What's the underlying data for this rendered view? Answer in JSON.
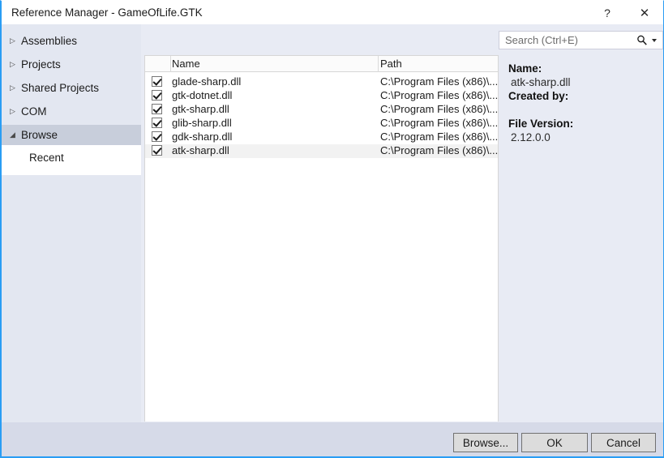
{
  "window": {
    "title": "Reference Manager - GameOfLife.GTK",
    "help_label": "?",
    "close_label": "✕"
  },
  "sidebar": {
    "items": [
      {
        "label": "Assemblies",
        "marker": "▷",
        "selected": false
      },
      {
        "label": "Projects",
        "marker": "▷",
        "selected": false
      },
      {
        "label": "Shared Projects",
        "marker": "▷",
        "selected": false
      },
      {
        "label": "COM",
        "marker": "▷",
        "selected": false
      },
      {
        "label": "Browse",
        "marker": "◢",
        "selected": true
      }
    ],
    "sub_item": {
      "label": "Recent"
    }
  },
  "search": {
    "placeholder": "Search (Ctrl+E)"
  },
  "list": {
    "columns": [
      "",
      "Name",
      "Path"
    ],
    "rows": [
      {
        "checked": true,
        "name": "glade-sharp.dll",
        "path": "C:\\Program Files (x86)\\...",
        "selected": false
      },
      {
        "checked": true,
        "name": "gtk-dotnet.dll",
        "path": "C:\\Program Files (x86)\\...",
        "selected": false
      },
      {
        "checked": true,
        "name": "gtk-sharp.dll",
        "path": "C:\\Program Files (x86)\\...",
        "selected": false
      },
      {
        "checked": true,
        "name": "glib-sharp.dll",
        "path": "C:\\Program Files (x86)\\...",
        "selected": false
      },
      {
        "checked": true,
        "name": "gdk-sharp.dll",
        "path": "C:\\Program Files (x86)\\...",
        "selected": false
      },
      {
        "checked": true,
        "name": "atk-sharp.dll",
        "path": "C:\\Program Files (x86)\\...",
        "selected": true
      }
    ]
  },
  "details": {
    "name_label": "Name:",
    "name_value": "atk-sharp.dll",
    "created_by_label": "Created by:",
    "created_by_value": "",
    "file_version_label": "File Version:",
    "file_version_value": "2.12.0.0"
  },
  "footer": {
    "browse_label": "Browse...",
    "ok_label": "OK",
    "cancel_label": "Cancel"
  },
  "colors": {
    "accent_border": "#2a9df4",
    "dialog_bg": "#e8ebf4",
    "sidebar_bg": "#e3e7f1",
    "sidebar_selected": "#c8cedb",
    "footer_bg": "#d6dae8",
    "list_bg": "#ffffff",
    "row_selected": "#f2f2f2"
  }
}
